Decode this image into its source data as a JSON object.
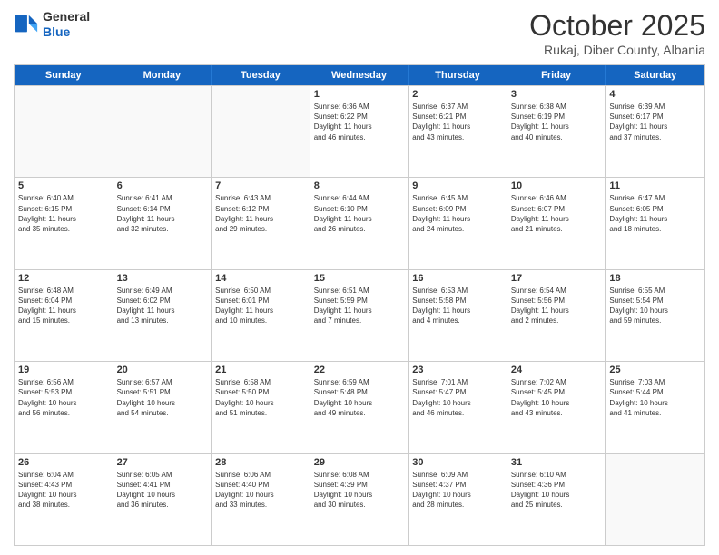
{
  "header": {
    "logo": {
      "general": "General",
      "blue": "Blue"
    },
    "month": "October 2025",
    "location": "Rukaj, Diber County, Albania"
  },
  "weekdays": [
    "Sunday",
    "Monday",
    "Tuesday",
    "Wednesday",
    "Thursday",
    "Friday",
    "Saturday"
  ],
  "weeks": [
    [
      {
        "day": "",
        "info": ""
      },
      {
        "day": "",
        "info": ""
      },
      {
        "day": "",
        "info": ""
      },
      {
        "day": "1",
        "info": "Sunrise: 6:36 AM\nSunset: 6:22 PM\nDaylight: 11 hours\nand 46 minutes."
      },
      {
        "day": "2",
        "info": "Sunrise: 6:37 AM\nSunset: 6:21 PM\nDaylight: 11 hours\nand 43 minutes."
      },
      {
        "day": "3",
        "info": "Sunrise: 6:38 AM\nSunset: 6:19 PM\nDaylight: 11 hours\nand 40 minutes."
      },
      {
        "day": "4",
        "info": "Sunrise: 6:39 AM\nSunset: 6:17 PM\nDaylight: 11 hours\nand 37 minutes."
      }
    ],
    [
      {
        "day": "5",
        "info": "Sunrise: 6:40 AM\nSunset: 6:15 PM\nDaylight: 11 hours\nand 35 minutes."
      },
      {
        "day": "6",
        "info": "Sunrise: 6:41 AM\nSunset: 6:14 PM\nDaylight: 11 hours\nand 32 minutes."
      },
      {
        "day": "7",
        "info": "Sunrise: 6:43 AM\nSunset: 6:12 PM\nDaylight: 11 hours\nand 29 minutes."
      },
      {
        "day": "8",
        "info": "Sunrise: 6:44 AM\nSunset: 6:10 PM\nDaylight: 11 hours\nand 26 minutes."
      },
      {
        "day": "9",
        "info": "Sunrise: 6:45 AM\nSunset: 6:09 PM\nDaylight: 11 hours\nand 24 minutes."
      },
      {
        "day": "10",
        "info": "Sunrise: 6:46 AM\nSunset: 6:07 PM\nDaylight: 11 hours\nand 21 minutes."
      },
      {
        "day": "11",
        "info": "Sunrise: 6:47 AM\nSunset: 6:05 PM\nDaylight: 11 hours\nand 18 minutes."
      }
    ],
    [
      {
        "day": "12",
        "info": "Sunrise: 6:48 AM\nSunset: 6:04 PM\nDaylight: 11 hours\nand 15 minutes."
      },
      {
        "day": "13",
        "info": "Sunrise: 6:49 AM\nSunset: 6:02 PM\nDaylight: 11 hours\nand 13 minutes."
      },
      {
        "day": "14",
        "info": "Sunrise: 6:50 AM\nSunset: 6:01 PM\nDaylight: 11 hours\nand 10 minutes."
      },
      {
        "day": "15",
        "info": "Sunrise: 6:51 AM\nSunset: 5:59 PM\nDaylight: 11 hours\nand 7 minutes."
      },
      {
        "day": "16",
        "info": "Sunrise: 6:53 AM\nSunset: 5:58 PM\nDaylight: 11 hours\nand 4 minutes."
      },
      {
        "day": "17",
        "info": "Sunrise: 6:54 AM\nSunset: 5:56 PM\nDaylight: 11 hours\nand 2 minutes."
      },
      {
        "day": "18",
        "info": "Sunrise: 6:55 AM\nSunset: 5:54 PM\nDaylight: 10 hours\nand 59 minutes."
      }
    ],
    [
      {
        "day": "19",
        "info": "Sunrise: 6:56 AM\nSunset: 5:53 PM\nDaylight: 10 hours\nand 56 minutes."
      },
      {
        "day": "20",
        "info": "Sunrise: 6:57 AM\nSunset: 5:51 PM\nDaylight: 10 hours\nand 54 minutes."
      },
      {
        "day": "21",
        "info": "Sunrise: 6:58 AM\nSunset: 5:50 PM\nDaylight: 10 hours\nand 51 minutes."
      },
      {
        "day": "22",
        "info": "Sunrise: 6:59 AM\nSunset: 5:48 PM\nDaylight: 10 hours\nand 49 minutes."
      },
      {
        "day": "23",
        "info": "Sunrise: 7:01 AM\nSunset: 5:47 PM\nDaylight: 10 hours\nand 46 minutes."
      },
      {
        "day": "24",
        "info": "Sunrise: 7:02 AM\nSunset: 5:45 PM\nDaylight: 10 hours\nand 43 minutes."
      },
      {
        "day": "25",
        "info": "Sunrise: 7:03 AM\nSunset: 5:44 PM\nDaylight: 10 hours\nand 41 minutes."
      }
    ],
    [
      {
        "day": "26",
        "info": "Sunrise: 6:04 AM\nSunset: 4:43 PM\nDaylight: 10 hours\nand 38 minutes."
      },
      {
        "day": "27",
        "info": "Sunrise: 6:05 AM\nSunset: 4:41 PM\nDaylight: 10 hours\nand 36 minutes."
      },
      {
        "day": "28",
        "info": "Sunrise: 6:06 AM\nSunset: 4:40 PM\nDaylight: 10 hours\nand 33 minutes."
      },
      {
        "day": "29",
        "info": "Sunrise: 6:08 AM\nSunset: 4:39 PM\nDaylight: 10 hours\nand 30 minutes."
      },
      {
        "day": "30",
        "info": "Sunrise: 6:09 AM\nSunset: 4:37 PM\nDaylight: 10 hours\nand 28 minutes."
      },
      {
        "day": "31",
        "info": "Sunrise: 6:10 AM\nSunset: 4:36 PM\nDaylight: 10 hours\nand 25 minutes."
      },
      {
        "day": "",
        "info": ""
      }
    ]
  ]
}
